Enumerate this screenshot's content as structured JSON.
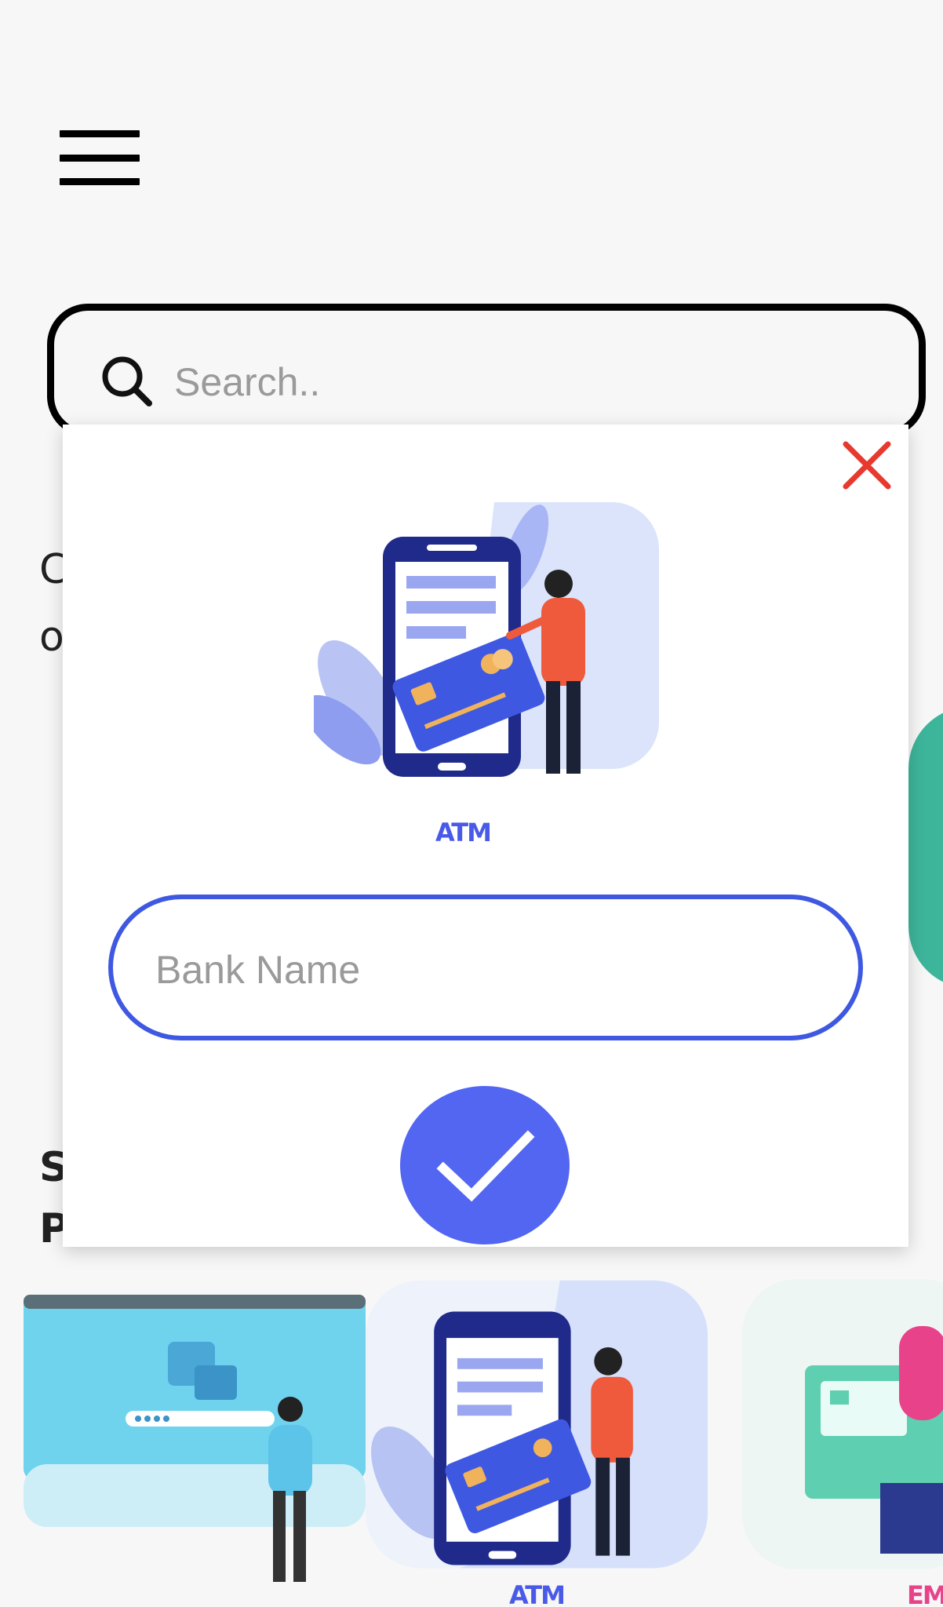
{
  "header": {
    "menu_icon": "hamburger-menu-icon"
  },
  "search": {
    "placeholder": "Search..",
    "value": "",
    "icon": "search-icon"
  },
  "background": {
    "section1_line1": "C",
    "section1_line2": "o",
    "section2_line1": "S",
    "section2_line2": "P",
    "cards": [
      {
        "label": ""
      },
      {
        "label": "ATM"
      },
      {
        "label": "EM"
      }
    ]
  },
  "modal": {
    "close_icon": "close-icon",
    "illustration_label": "ATM",
    "bank_field": {
      "placeholder": "Bank Name",
      "value": ""
    },
    "confirm_icon": "checkmark-icon"
  },
  "colors": {
    "accent": "#5266f2",
    "field_border": "#3e58e2",
    "close": "#e8392f",
    "label": "#4a5ae8"
  }
}
